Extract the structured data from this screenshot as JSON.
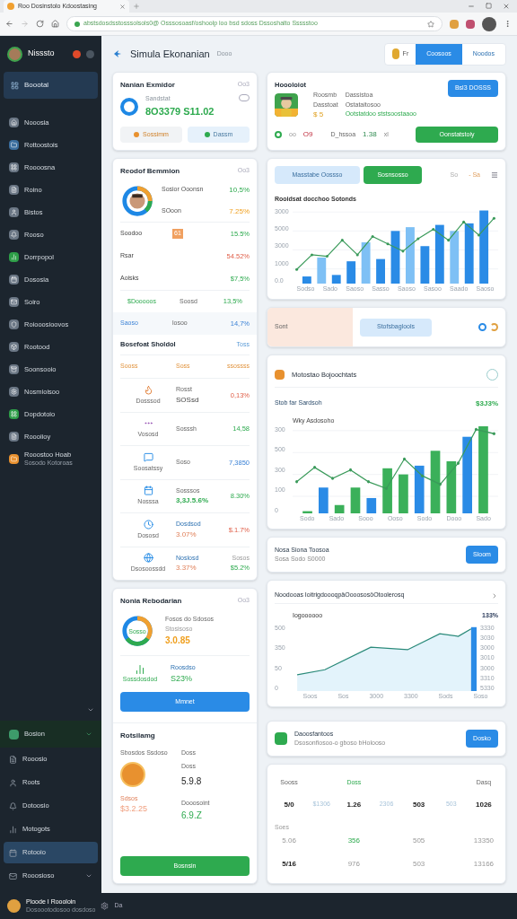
{
  "browser": {
    "tab_title": "Roo Dosinstolo Kdoostasing",
    "address": "abstsdosdsstosssolsols0@ Osssosoasf/oshoolp loo bsd sdoss Dssoshalto Ssssstoo"
  },
  "sidebar": {
    "user": "Nisssto",
    "top_item": {
      "label": "Boootal",
      "selected": true
    },
    "items": [
      {
        "label": "Nooosia",
        "color": "#6b7785"
      },
      {
        "label": "Rottoostois",
        "color": "#3b6e9e"
      },
      {
        "label": "Roooosna",
        "color": "#6b7785"
      },
      {
        "label": "Roino",
        "color": "#6b7785"
      },
      {
        "label": "Bistos",
        "color": "#6b7785"
      },
      {
        "label": "Rooso",
        "color": "#6b7785"
      },
      {
        "label": "Dorrpopol",
        "color": "#2e9e48"
      },
      {
        "label": "Dososia",
        "color": "#6b7785"
      },
      {
        "label": "Soiro",
        "color": "#6b7785"
      },
      {
        "label": "Roiooosioovos",
        "color": "#6b7785"
      },
      {
        "label": "Rootood",
        "color": "#6b7785"
      },
      {
        "label": "Soonsooio",
        "color": "#6b7785"
      },
      {
        "label": "Nosmioisoo",
        "color": "#6b7785"
      },
      {
        "label": "Dopdotoio",
        "color": "#2e9e48"
      },
      {
        "label": "Roooiioy",
        "color": "#6b7785"
      },
      {
        "label": "Rooostoo Hoab",
        "sub": "Sosodo Kotoroas",
        "color": "#e8912f"
      }
    ],
    "group": {
      "label": "Bosion",
      "expanded": true,
      "items": [
        {
          "label": "Rooosio",
          "selected": false
        },
        {
          "label": "Roots",
          "selected": false
        },
        {
          "label": "Dotoosio",
          "selected": false
        },
        {
          "label": "Motogots",
          "selected": false
        },
        {
          "label": "Rotooio",
          "selected": true
        },
        {
          "label": "Rooosioso",
          "selected": false
        }
      ]
    },
    "footer": {
      "name": "Ploode I Roooloin",
      "sub": "Dosoootodosoo dosdoso",
      "extra": "Da"
    }
  },
  "header": {
    "title": "Simula Ekonanian",
    "sub": "Dooo",
    "buttons": [
      "Fr",
      "Coosoos",
      "Noodos"
    ]
  },
  "balance": {
    "title": "Nanian Exmidor",
    "corner": "Oo3",
    "label": "Sandstat",
    "value": "8O3379 S11.02",
    "actions": [
      "Sossimm",
      "Dassm"
    ]
  },
  "profile": {
    "title": "Hoooloiot",
    "col1": [
      "Roosmb",
      "Dasstoat",
      "$ 5"
    ],
    "col2": [
      "Dassistoa",
      "Ostataitosoo",
      "Ootstatdoo ststsoostaaoo"
    ],
    "primary": "Bsl3 DOSSS",
    "stat1": "oo",
    "stat2": "O9",
    "stat3_label": "D_hssoa",
    "stat3": "1.38",
    "stat4": "xl",
    "cta": "Oonstatstoiy"
  },
  "report": {
    "title": "Reodof Bemmion",
    "corner": "Oo3",
    "top": [
      {
        "label": "Sosior Ooonsn",
        "value": "10,5%",
        "kind": "positive"
      },
      {
        "label": "SOoon",
        "value": "7.25%",
        "kind": "warning"
      }
    ],
    "rows": [
      {
        "label": "Soodoo",
        "mid": "61",
        "value": "15.5%",
        "kind": "positive"
      },
      {
        "label": "Rsar",
        "value": "54.52%",
        "kind": "negative"
      },
      {
        "label": "Aoisks",
        "value": "$7,5%",
        "kind": "positive"
      },
      {
        "label": "$Dooooos",
        "mid": "Soosd",
        "value": "13,5%",
        "kind": "positive"
      },
      {
        "label": "Saoso",
        "mid": "losoo",
        "value": "14,7%",
        "kind": "neutral"
      }
    ]
  },
  "list": {
    "title": "Bosefoat Sholdol",
    "corner": "Toss",
    "head": [
      "Sooss",
      "Soss",
      "ssossss"
    ],
    "rows": [
      {
        "caption": "Dosssod",
        "label": "Rosst",
        "main": "SOSsd",
        "value": "0,13%",
        "kind": "negative"
      },
      {
        "caption": "Vososd",
        "label": "Sosssh",
        "value": "14,58",
        "kind": "positive"
      },
      {
        "caption": "Soosatssy",
        "label": "Soso",
        "value": "7,3850",
        "kind": "neutral"
      },
      {
        "caption": "Nosssa",
        "label": "Sosssos",
        "main": "3,3J.5.6%",
        "value": "8.30%",
        "kind": "positive"
      },
      {
        "caption": "Dososd",
        "label": "Dosdsod",
        "main": "3.07%",
        "value": "$.1.7%",
        "kind": "negative"
      },
      {
        "caption": "Dsosoossdd",
        "label": "Noslosd",
        "sub": "Sosos",
        "main": "3.37%",
        "value": "$5.2%",
        "kind": "positive"
      }
    ]
  },
  "chart1": {
    "tabs": [
      {
        "label": "Masstabe Oossso",
        "selected": true
      },
      {
        "label": "Sosnsosso",
        "selected": false
      }
    ],
    "range": [
      "So",
      "- Sa"
    ],
    "title": "Rooidsat docchoo Sotonds",
    "y_labels": [
      "3000",
      "5000",
      "3000",
      "1000",
      "0.0"
    ],
    "x_labels": [
      "Sodso",
      "Sado",
      "Saoso",
      "Sasso",
      "Saoso",
      "Sasoo",
      "Saado",
      "Saoso"
    ]
  },
  "strip": {
    "label": "Sont",
    "button": "Stofsbaglools"
  },
  "chart2": {
    "title": "Motostao Bojoochtats",
    "subtitle": "Stob far Sardsoh",
    "value": "$3J3%",
    "note": "Wky Asdosoho",
    "y_labels": [
      "300",
      "500",
      "300",
      "100",
      "0"
    ],
    "x_labels": [
      "Sodo",
      "Sado",
      "Sooo",
      "Ooso",
      "Sodo",
      "Dooo",
      "Sado"
    ]
  },
  "notice": {
    "title": "Nosa Siona Toosoa",
    "sub": "Sosa Sodo S0000",
    "button": "Sloom"
  },
  "rate": {
    "title": "Nonia Rebodarian",
    "corner": "Oo3",
    "donut_label": "Sosso",
    "label1": "Fosos do Sdosos",
    "label1b": "Stosisoso",
    "value1": "3.0.85",
    "icon_label": "Sossdosdod",
    "label2": "Roosdso",
    "value2": "S23%",
    "button": "Mmnet"
  },
  "growth": {
    "title": "Noodooas IoitrigdoooqpäOooososöOtoolerosq",
    "series": "Iogoooooo",
    "value": "133%",
    "y_labels": [
      "500",
      "350",
      "50",
      "0"
    ],
    "x_labels": [
      "Soos",
      "Sos",
      "3000",
      "3300",
      "Sods",
      "Soso"
    ],
    "right_labels": [
      "3330",
      "3030",
      "3000",
      "3010",
      "3000",
      "3310",
      "5330"
    ]
  },
  "promo": {
    "title": "Daoosfantoos",
    "sub": "Dsosonfiosoo-o gboso bHolooso",
    "button": "Dosko"
  },
  "rating": {
    "title": "Rotsilamg",
    "label": "Sbosdos Ssdoso",
    "col": [
      "Doss",
      "Doss"
    ],
    "value1": "5.9.8",
    "small": "Sdsos",
    "value2_label": "Dooosoint",
    "big_orange": "$3.2.25",
    "value2": "6.9.Z",
    "button": "Bosnsin"
  },
  "table": {
    "rows": [
      [
        {
          "head": "Sooss",
          "text": "5/0",
          "kind": "main"
        },
        {
          "text": "$1306",
          "kind": "muted"
        },
        {
          "head": "Doss",
          "text": "1.26",
          "kind": "main"
        },
        {
          "text": "2306",
          "kind": "muted"
        },
        {
          "text": "503",
          "kind": "main"
        },
        {
          "text": "503",
          "kind": "muted"
        },
        {
          "head": "Dasq",
          "text": "1026",
          "kind": "main"
        }
      ],
      [
        {
          "text": "5.06",
          "kind": "light"
        },
        null,
        {
          "text": "356",
          "kind": "green"
        },
        null,
        {
          "text": "505",
          "kind": "light"
        },
        null,
        {
          "text": "13350",
          "kind": "light"
        }
      ],
      [
        {
          "text": "5/16",
          "kind": "main"
        },
        null,
        {
          "text": "976",
          "kind": "light"
        },
        null,
        {
          "text": "503",
          "kind": "light"
        },
        null,
        {
          "text": "13166",
          "kind": "light"
        }
      ]
    ],
    "row_label": "Soes"
  }
}
